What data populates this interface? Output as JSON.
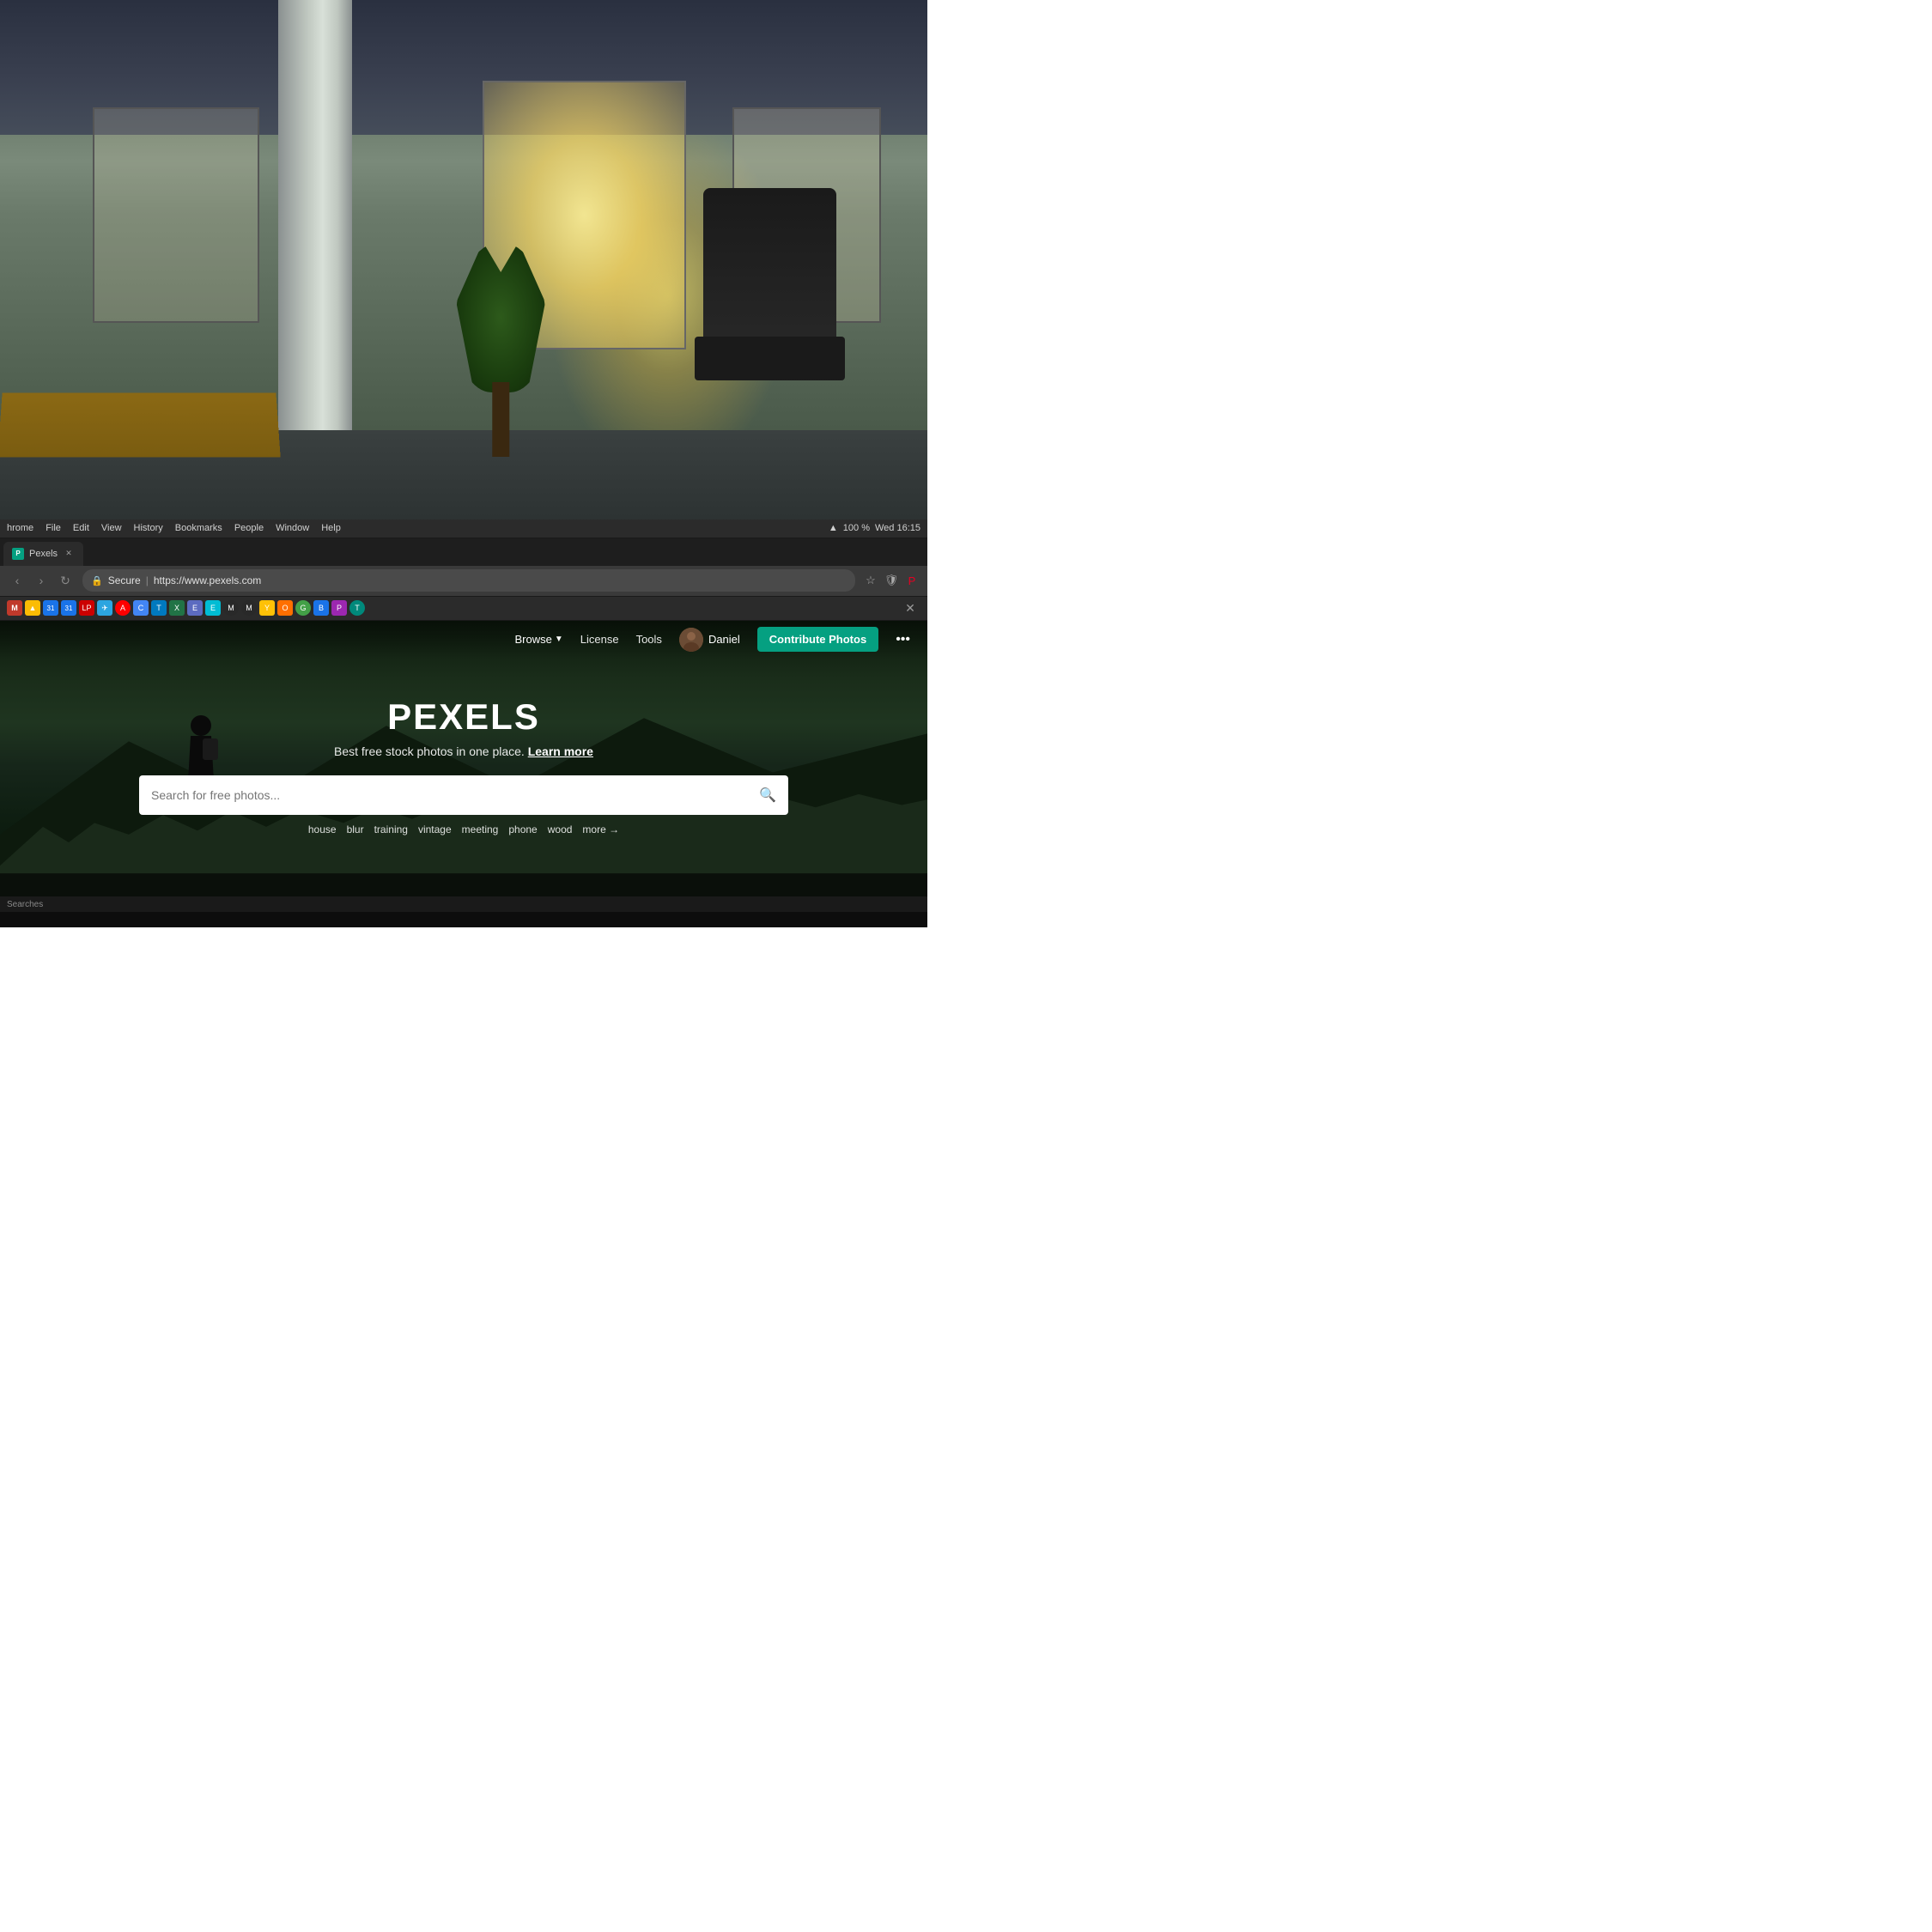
{
  "background": {
    "office_description": "Blurred office background with bright window light"
  },
  "browser": {
    "menu_items": [
      "hrome",
      "File",
      "Edit",
      "View",
      "History",
      "Bookmarks",
      "People",
      "Window",
      "Help"
    ],
    "time": "Wed 16:15",
    "battery": "100 %",
    "tab_title": "Pexels",
    "tab_favicon_text": "P",
    "url_protocol": "Secure",
    "url": "https://www.pexels.com",
    "status_bar_text": "Searches"
  },
  "pexels": {
    "nav": {
      "browse_label": "Browse",
      "license_label": "License",
      "tools_label": "Tools",
      "user_name": "Daniel",
      "contribute_label": "Contribute Photos",
      "more_icon": "•••"
    },
    "hero": {
      "title": "PEXELS",
      "subtitle": "Best free stock photos in one place.",
      "learn_more": "Learn more",
      "search_placeholder": "Search for free photos...",
      "suggestions": [
        "house",
        "blur",
        "training",
        "vintage",
        "meeting",
        "phone",
        "wood"
      ],
      "more_label": "more →"
    }
  }
}
